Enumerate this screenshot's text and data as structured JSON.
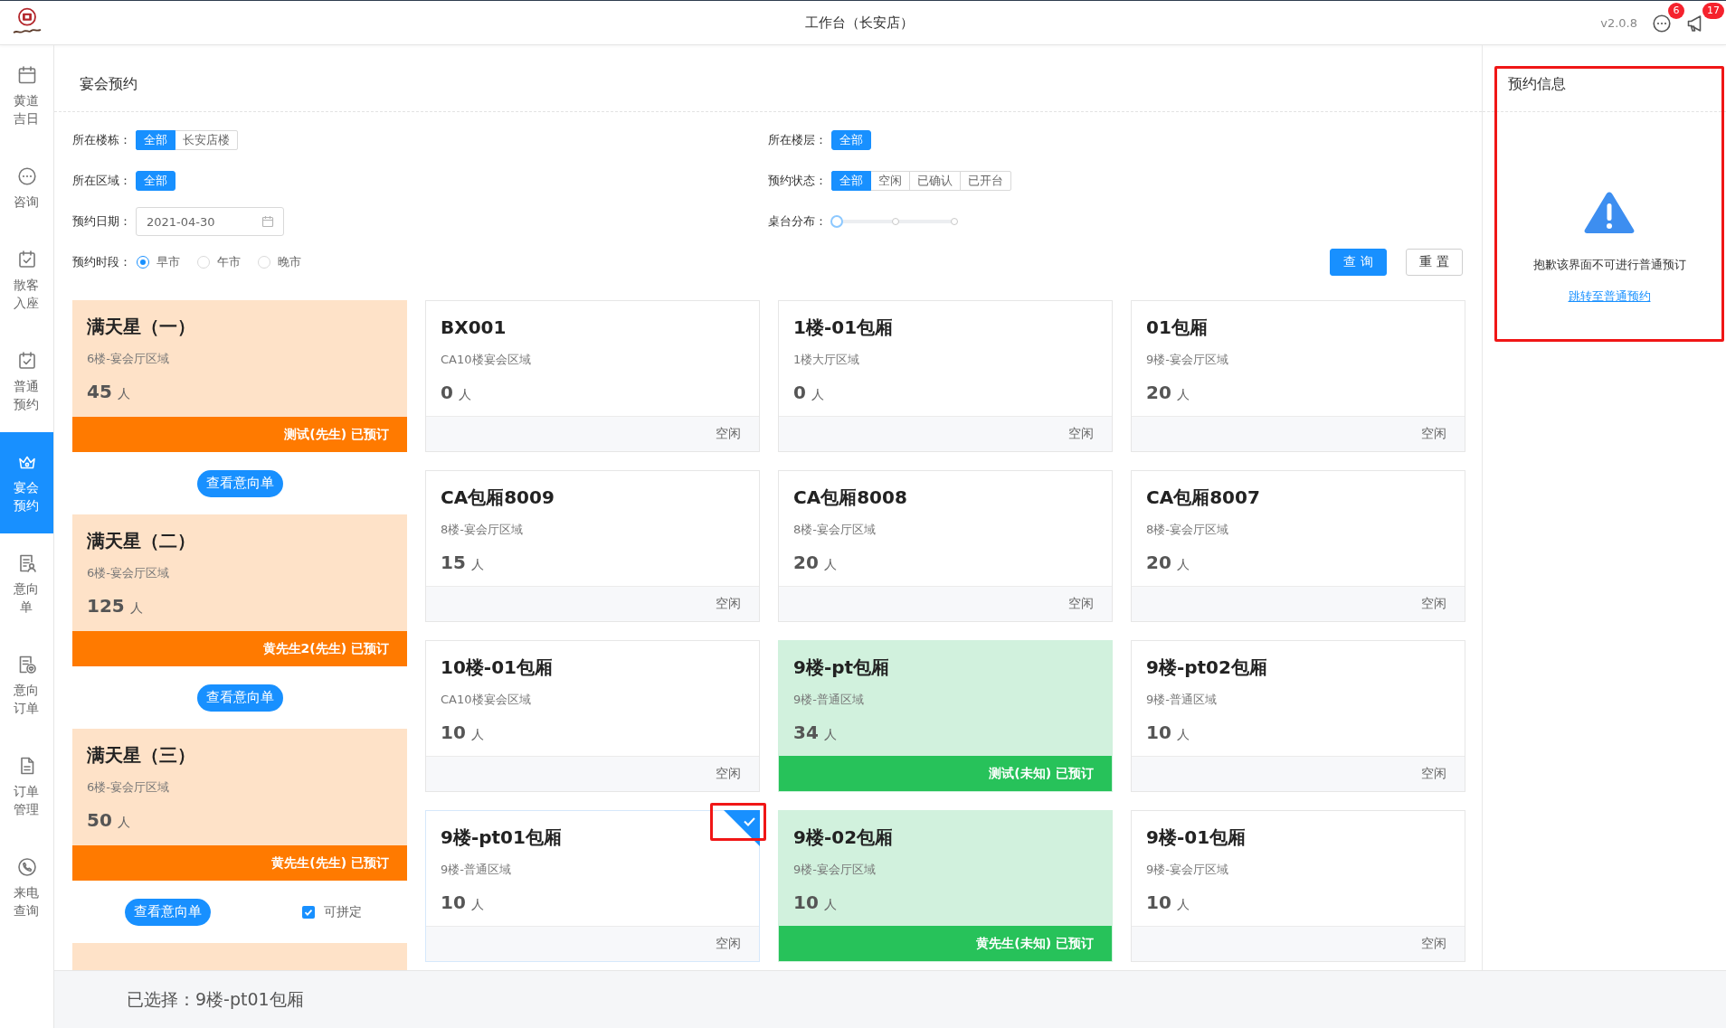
{
  "top_bar": {
    "title": "工作台（长安店）",
    "version": "v2.0.8",
    "notices": [
      {
        "kind": "message",
        "count": "6"
      },
      {
        "kind": "announcement",
        "count": "17"
      }
    ]
  },
  "sidebar": {
    "items": [
      {
        "kind": "almanac",
        "label": "黄道吉日",
        "selected": false
      },
      {
        "kind": "consult",
        "label": "咨询",
        "selected": false
      },
      {
        "kind": "walkin",
        "label": "散客入座",
        "selected": false
      },
      {
        "kind": "reserve",
        "label": "普通预约",
        "selected": false
      },
      {
        "kind": "banquet",
        "label": "宴会预约",
        "selected": true
      },
      {
        "kind": "intent",
        "label": "意向单",
        "selected": false
      },
      {
        "kind": "intent_order",
        "label": "意向订单",
        "selected": false
      },
      {
        "kind": "orders",
        "label": "订单管理",
        "selected": false
      },
      {
        "kind": "calls",
        "label": "来电查询",
        "selected": false
      }
    ]
  },
  "main": {
    "title": "宴会预约",
    "filter_rows": [
      {
        "fields": [
          {
            "kind": "segmented",
            "label": "所在楼栋：",
            "options": [
              {
                "label": "全部",
                "selected": true
              },
              {
                "label": "长安店楼",
                "selected": false
              }
            ]
          },
          {
            "kind": "segmented",
            "label": "所在楼层：",
            "options": [
              {
                "label": "全部",
                "selected": true
              }
            ]
          }
        ]
      },
      {
        "fields": [
          {
            "kind": "segmented",
            "label": "所在区域：",
            "options": [
              {
                "label": "全部",
                "selected": true
              }
            ]
          },
          {
            "kind": "segmented",
            "label": "预约状态：",
            "options": [
              {
                "label": "全部",
                "selected": true
              },
              {
                "label": "空闲",
                "selected": false
              },
              {
                "label": "已确认",
                "selected": false
              },
              {
                "label": "已开台",
                "selected": false
              }
            ]
          }
        ]
      },
      {
        "fields": [
          {
            "kind": "date",
            "label": "预约日期：",
            "value": "2021-04-30"
          },
          {
            "kind": "slider",
            "label": "桌台分布：",
            "level": 0
          }
        ]
      },
      {
        "fields": [
          {
            "kind": "radio",
            "label": "预约时段：",
            "options": [
              {
                "label": "早市",
                "selected": true
              },
              {
                "label": "午市",
                "selected": false
              },
              {
                "label": "晚市",
                "selected": false
              }
            ]
          }
        ]
      }
    ],
    "actions": [
      {
        "kind": "query",
        "label": "查询"
      },
      {
        "kind": "reset",
        "label": "重置"
      }
    ],
    "banquet_halls": [
      {
        "name": "满天星（一）",
        "area": "6楼-宴会厅区域",
        "capacity": "45",
        "unit": "人",
        "booked": true,
        "status": "测试(先生) 已预订",
        "action": "查看意向单"
      },
      {
        "name": "满天星（二）",
        "area": "6楼-宴会厅区域",
        "capacity": "125",
        "unit": "人",
        "booked": true,
        "status": "黄先生2(先生) 已预订",
        "action": "查看意向单"
      },
      {
        "name": "满天星（三）",
        "area": "6楼-宴会厅区域",
        "capacity": "50",
        "unit": "人",
        "booked": true,
        "status": "黄先生(先生) 已预订",
        "action": "查看意向单",
        "combine": {
          "label": "可拼定",
          "checked": true
        }
      }
    ],
    "banquet_halls_more": true,
    "rooms": [
      {
        "name": "BX001",
        "area": "CA10楼宴会区域",
        "capacity": "0",
        "unit": "人",
        "booked": false,
        "status": "空闲",
        "selected": false,
        "highlighted": false
      },
      {
        "name": "1楼-01包厢",
        "area": "1楼大厅区域",
        "capacity": "0",
        "unit": "人",
        "booked": false,
        "status": "空闲",
        "selected": false,
        "highlighted": false
      },
      {
        "name": "01包厢",
        "area": "9楼-宴会厅区域",
        "capacity": "20",
        "unit": "人",
        "booked": false,
        "status": "空闲",
        "selected": false,
        "highlighted": false
      },
      {
        "name": "CA包厢8009",
        "area": "8楼-宴会厅区域",
        "capacity": "15",
        "unit": "人",
        "booked": false,
        "status": "空闲",
        "selected": false,
        "highlighted": false
      },
      {
        "name": "CA包厢8008",
        "area": "8楼-宴会厅区域",
        "capacity": "20",
        "unit": "人",
        "booked": false,
        "status": "空闲",
        "selected": false,
        "highlighted": false
      },
      {
        "name": "CA包厢8007",
        "area": "8楼-宴会厅区域",
        "capacity": "20",
        "unit": "人",
        "booked": false,
        "status": "空闲",
        "selected": false,
        "highlighted": false
      },
      {
        "name": "10楼-01包厢",
        "area": "CA10楼宴会区域",
        "capacity": "10",
        "unit": "人",
        "booked": false,
        "status": "空闲",
        "selected": false,
        "highlighted": false
      },
      {
        "name": "9楼-pt包厢",
        "area": "9楼-普通区域",
        "capacity": "34",
        "unit": "人",
        "booked": true,
        "status": "测试(未知) 已预订",
        "selected": false,
        "highlighted": false
      },
      {
        "name": "9楼-pt02包厢",
        "area": "9楼-普通区域",
        "capacity": "10",
        "unit": "人",
        "booked": false,
        "status": "空闲",
        "selected": false,
        "highlighted": false
      },
      {
        "name": "9楼-pt01包厢",
        "area": "9楼-普通区域",
        "capacity": "10",
        "unit": "人",
        "booked": false,
        "status": "空闲",
        "selected": true,
        "highlighted": true
      },
      {
        "name": "9楼-02包厢",
        "area": "9楼-宴会厅区域",
        "capacity": "10",
        "unit": "人",
        "booked": true,
        "status": "黄先生(未知) 已预订",
        "selected": false,
        "highlighted": false
      },
      {
        "name": "9楼-01包厢",
        "area": "9楼-宴会厅区域",
        "capacity": "10",
        "unit": "人",
        "booked": false,
        "status": "空闲",
        "selected": false,
        "highlighted": false
      }
    ]
  },
  "info_panel": {
    "title": "预约信息",
    "highlighted": true,
    "message": "抱歉该界面不可进行普通预订",
    "link": "跳转至普通预约"
  },
  "selection_bar": {
    "text": "已选择：9楼-pt01包厢"
  }
}
